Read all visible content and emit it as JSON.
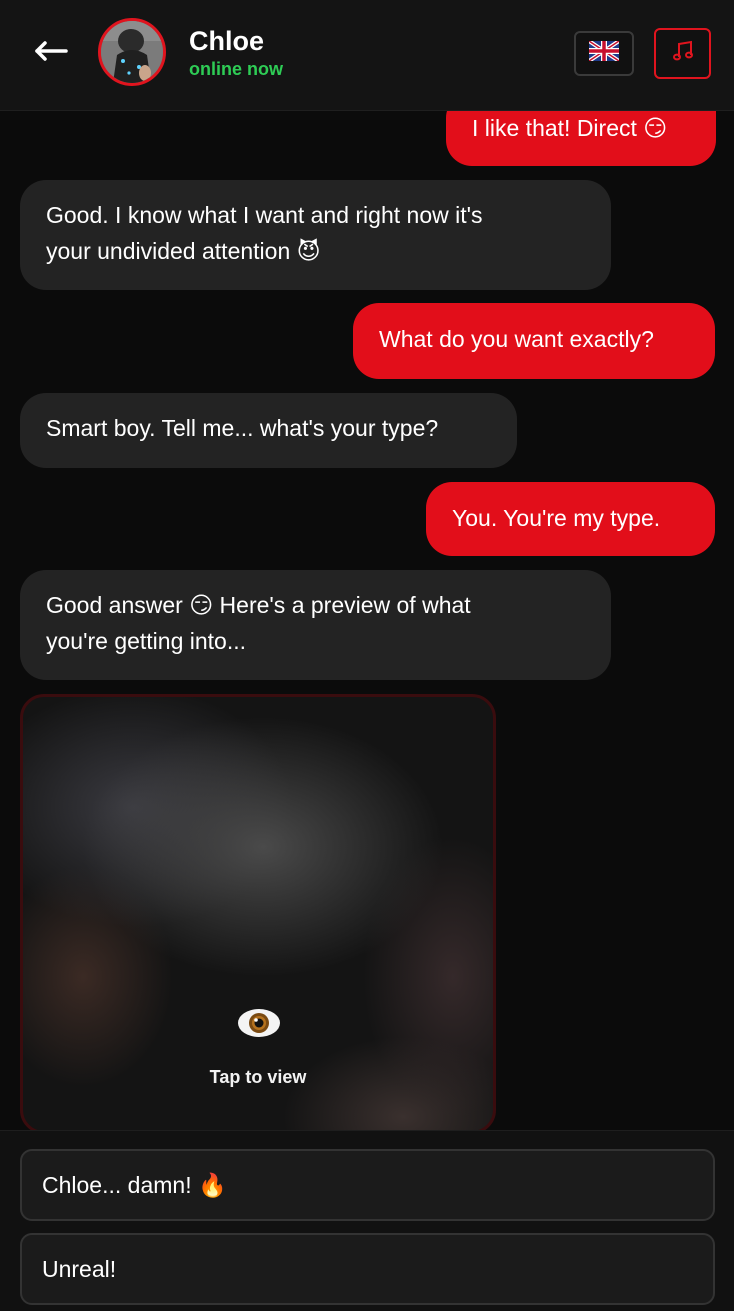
{
  "header": {
    "back_icon": "arrow-left-icon",
    "contact_name": "Chloe",
    "status": "online now",
    "status_color": "#2ecc55",
    "language_icon": "uk-flag-icon",
    "music_icon": "music-note-icon",
    "accent_color": "#e0141e"
  },
  "messages": [
    {
      "from": "me",
      "text": "I like that! Direct 😏"
    },
    {
      "from": "chloe",
      "line1": "Good. I know what I want and right now it's",
      "line2": "your undivided attention 😈"
    },
    {
      "from": "me",
      "text": "What do you want exactly?"
    },
    {
      "from": "chloe",
      "text": "Smart boy. Tell me... what's your type?"
    },
    {
      "from": "me",
      "text": "You. You're my type."
    },
    {
      "from": "chloe",
      "line1": "Good answer 😏 Here's a preview of what",
      "line2": "you're getting into..."
    }
  ],
  "media": {
    "icon": "eye-icon",
    "label": "Tap to view"
  },
  "quick_replies": [
    {
      "label": "Chloe... damn! 🔥"
    },
    {
      "label": "Unreal!"
    }
  ]
}
